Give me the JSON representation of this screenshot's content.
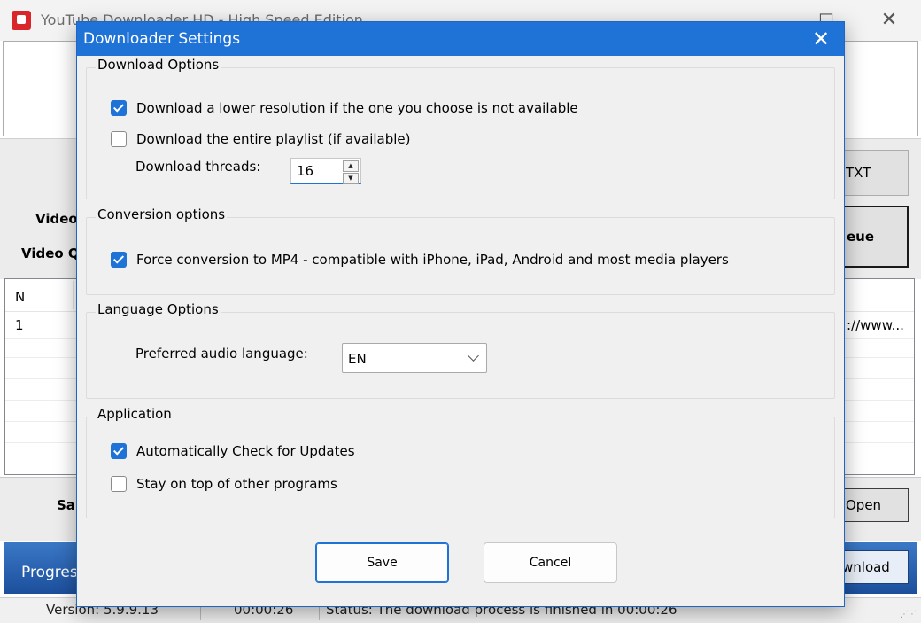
{
  "main_window": {
    "title": "YouTube Downloader HD - High Speed Edition",
    "label_video_1": "Video",
    "label_video_2": "Video Q",
    "button_txt": "TXT",
    "button_queue": "eue",
    "list_header_n": "N",
    "list_row_1_n": "1",
    "list_row_1_url": "://www...",
    "label_save": "Sa",
    "button_open": "Open",
    "label_progress": "Progres",
    "button_download": "wnload",
    "status_version": "Version: 5.9.9.13",
    "status_time": "00:00:26",
    "status_text": "Status: The download process is finished in 00:00:26"
  },
  "dialog": {
    "title": "Downloader Settings",
    "download_options": {
      "title": "Download Options",
      "lower_resolution": {
        "label": "Download a lower resolution if the one you choose is not available",
        "checked": true
      },
      "entire_playlist": {
        "label": "Download the entire playlist (if available)",
        "checked": false
      },
      "threads_label": "Download threads:",
      "threads_value": "16"
    },
    "conversion_options": {
      "title": "Conversion options",
      "force_mp4": {
        "label": "Force conversion to MP4 - compatible with iPhone, iPad, Android and most media players",
        "checked": true
      }
    },
    "language_options": {
      "title": "Language Options",
      "audio_label": "Preferred audio language:",
      "audio_value": "EN"
    },
    "application": {
      "title": "Application",
      "auto_update": {
        "label": "Automatically Check for Updates",
        "checked": true
      },
      "stay_on_top": {
        "label": "Stay on top of other programs",
        "checked": false
      }
    },
    "save_label": "Save",
    "cancel_label": "Cancel"
  },
  "colors": {
    "accent": "#1f72d6",
    "progress": "#2b63b4"
  },
  "icons": {
    "close": "close-icon",
    "app": "app-icon",
    "check": "checkmark-icon",
    "chevron": "chevron-down-icon"
  }
}
